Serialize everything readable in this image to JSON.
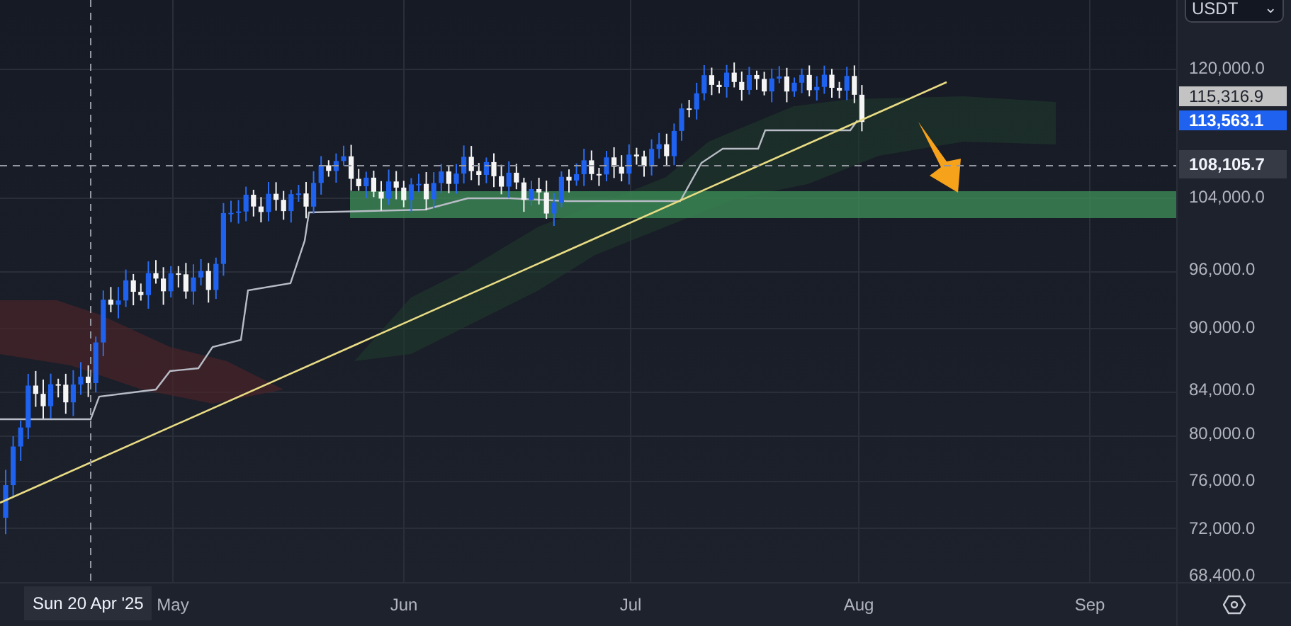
{
  "quote_selector": {
    "label": "USDT",
    "caret": "⌄"
  },
  "price_axis": {
    "labels": [
      "120,000.0",
      "104,000.0",
      "96,000.0",
      "90,000.0",
      "84,000.0",
      "80,000.0",
      "76,000.0",
      "72,000.0",
      "68,400.0"
    ]
  },
  "price_badges": [
    {
      "label": "115,316.9",
      "kind": "previous"
    },
    {
      "label": "113,563.1",
      "kind": "last"
    }
  ],
  "time_axis": {
    "labels": [
      "May",
      "Jun",
      "Jul",
      "Aug",
      "Sep"
    ]
  },
  "crosshair": {
    "time_label": "Sun 20 Apr '25",
    "price_label": "108,105.7"
  }
}
